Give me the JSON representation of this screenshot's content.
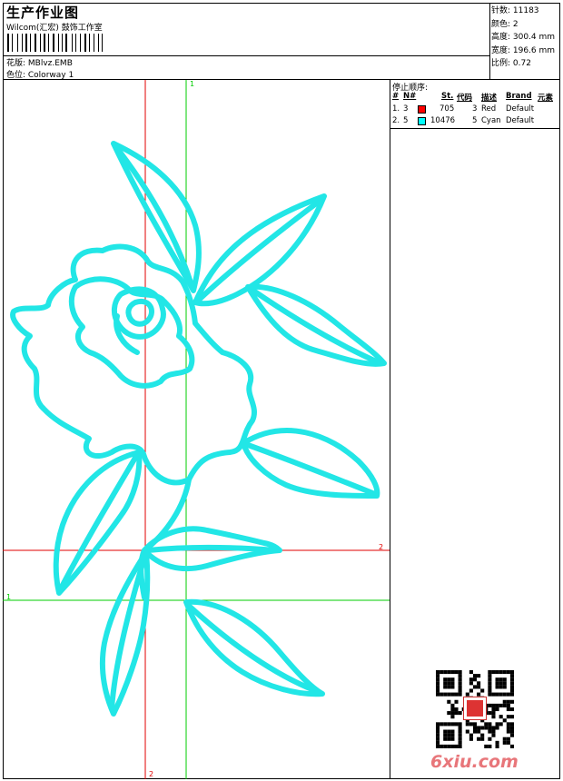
{
  "header": {
    "title": "生产作业图",
    "studio": "Wilcom(汇宏) 鼓饰工作室",
    "design_label": "花版: MBlvz.EMB",
    "colorway_label": "色位: Colorway 1"
  },
  "stats": {
    "stitches": "针数: 11183",
    "colors": "颜色: 2",
    "height": "高度: 300.4 mm",
    "width": "宽度: 196.6 mm",
    "scale": "比例: 0.72"
  },
  "stop_sequence": {
    "title": "停止顺序:",
    "headers": [
      "#",
      "N#",
      "St.",
      "代码",
      "描述",
      "Brand",
      "元素"
    ],
    "rows": [
      {
        "num": "1.",
        "n": "3",
        "color": "#ff0000",
        "st": "705",
        "code": "3",
        "desc": "Red",
        "brand": "Default"
      },
      {
        "num": "2.",
        "n": "5",
        "color": "#00ffff",
        "st": "10476",
        "code": "5",
        "desc": "Cyan",
        "brand": "Default"
      }
    ]
  },
  "guides": {
    "green_v_top": "1",
    "green_h_left": "1",
    "red_h_right": "2",
    "red_v_bottom": "2"
  },
  "colors": {
    "embroidery": "#22e6e6",
    "guide_red": "#e00000",
    "guide_green": "#00cc00",
    "watermark": "#e8767a"
  },
  "watermark": "6xiu.com"
}
